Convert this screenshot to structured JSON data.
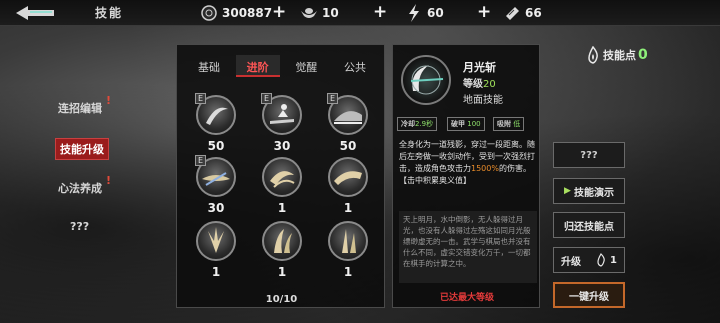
{
  "header": {
    "title": "技能",
    "resources": [
      {
        "icon": "coin-icon",
        "value": "300887"
      },
      {
        "icon": "ingot-icon",
        "value": "10"
      },
      {
        "icon": "stamina-icon",
        "value": "60"
      },
      {
        "icon": "ticket-icon",
        "value": "66"
      }
    ]
  },
  "nav": {
    "items": [
      {
        "label": "连招编辑",
        "badge": "!"
      },
      {
        "label": "技能升级",
        "badge": ""
      },
      {
        "label": "心法养成",
        "badge": "!"
      },
      {
        "label": "???",
        "badge": ""
      }
    ]
  },
  "tabs": [
    "基础",
    "进阶",
    "觉醒",
    "公共"
  ],
  "skills": [
    {
      "icon": "crescent-slash-icon",
      "tag": "E",
      "value": "50"
    },
    {
      "icon": "dash-figure-icon",
      "tag": "E",
      "value": "30"
    },
    {
      "icon": "ground-wave-icon",
      "tag": "E",
      "value": "50"
    },
    {
      "icon": "spinning-blade-icon",
      "tag": "E",
      "value": "30"
    },
    {
      "icon": "whirlwind-icon",
      "tag": "",
      "value": "1"
    },
    {
      "icon": "wave-strike-icon",
      "tag": "",
      "value": "1"
    },
    {
      "icon": "burst-icon",
      "tag": "",
      "value": "1"
    },
    {
      "icon": "rising-claw-icon",
      "tag": "",
      "value": "1"
    },
    {
      "icon": "spike-icon",
      "tag": "",
      "value": "1"
    }
  ],
  "page_indicator": "10/10",
  "detail": {
    "name": "月光斩",
    "level_label": "等级",
    "level_value": "20",
    "type": "地面技能",
    "stats": [
      {
        "label": "冷却",
        "value": "2.9秒"
      },
      {
        "label": "破甲",
        "value": "100"
      },
      {
        "label": "吸附",
        "value": "低"
      }
    ],
    "desc_pre": "全身化为一道残影，穿过一段距离。随后左旁做一收剑动作，受到一次强烈打击，造成角色攻击力",
    "desc_highlight": "1500%",
    "desc_post": "的伤害。",
    "desc_tag": "【击中积累奥义值】",
    "lore": "天上明月，水中倒影，无人躲得过月光，也没有人躲得过左殇这如同月光般缥缈虚无的一击。武学与棋局也并没有什么不同，虚实交错变化万千，一切都在棋手的计算之中。",
    "max_level": "已达最大等级"
  },
  "side": {
    "skill_points_label": "技能点",
    "skill_points": "0",
    "unknown_btn": "???",
    "demo_btn": "技能演示",
    "refund_btn": "归还技能点",
    "upgrade_label": "升级",
    "upgrade_cost": "1",
    "one_click_btn": "一键升级"
  },
  "colors": {
    "accent_red": "#c83030",
    "level_green": "#9fe05a",
    "highlight_orange": "#e88b2a",
    "upgrade_border": "#c4682a"
  }
}
